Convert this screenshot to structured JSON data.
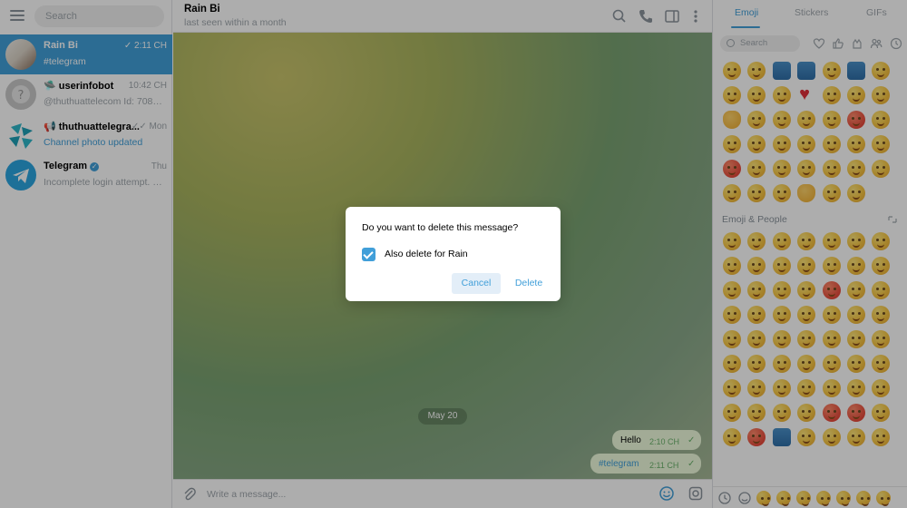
{
  "sidebar": {
    "search_placeholder": "Search",
    "chats": [
      {
        "name": "Rain Bi",
        "time": "2:11 CH",
        "preview": "#telegram",
        "check": "✓"
      },
      {
        "name": "userinfobot",
        "time": "10:42 CH",
        "preview": "@thuthuattelecom Id: 70803..."
      },
      {
        "name": "thuthuattelegra...",
        "time": "Mon",
        "preview": "Channel photo updated",
        "check": "✓✓"
      },
      {
        "name": "Telegram",
        "time": "Thu",
        "preview": "Incomplete login attempt. D..."
      }
    ]
  },
  "header": {
    "title": "Rain Bi",
    "status": "last seen within a month"
  },
  "chat": {
    "date": "May 20",
    "messages": [
      {
        "text": "Hello",
        "time": "2:10 CH",
        "check": "✓"
      },
      {
        "text": "#telegram",
        "time": "2:11 CH",
        "check": "✓"
      }
    ]
  },
  "input": {
    "placeholder": "Write a message..."
  },
  "emoji_panel": {
    "tabs": [
      "Emoji",
      "Stickers",
      "GIFs"
    ],
    "search_placeholder": "Search",
    "section_title": "Emoji & People"
  },
  "dialog": {
    "question": "Do you want to delete this message?",
    "checkbox_label": "Also delete for Rain",
    "checkbox_checked": true,
    "cancel_label": "Cancel",
    "delete_label": "Delete"
  },
  "colors": {
    "accent": "#419fd9",
    "bubble": "#effdde"
  }
}
